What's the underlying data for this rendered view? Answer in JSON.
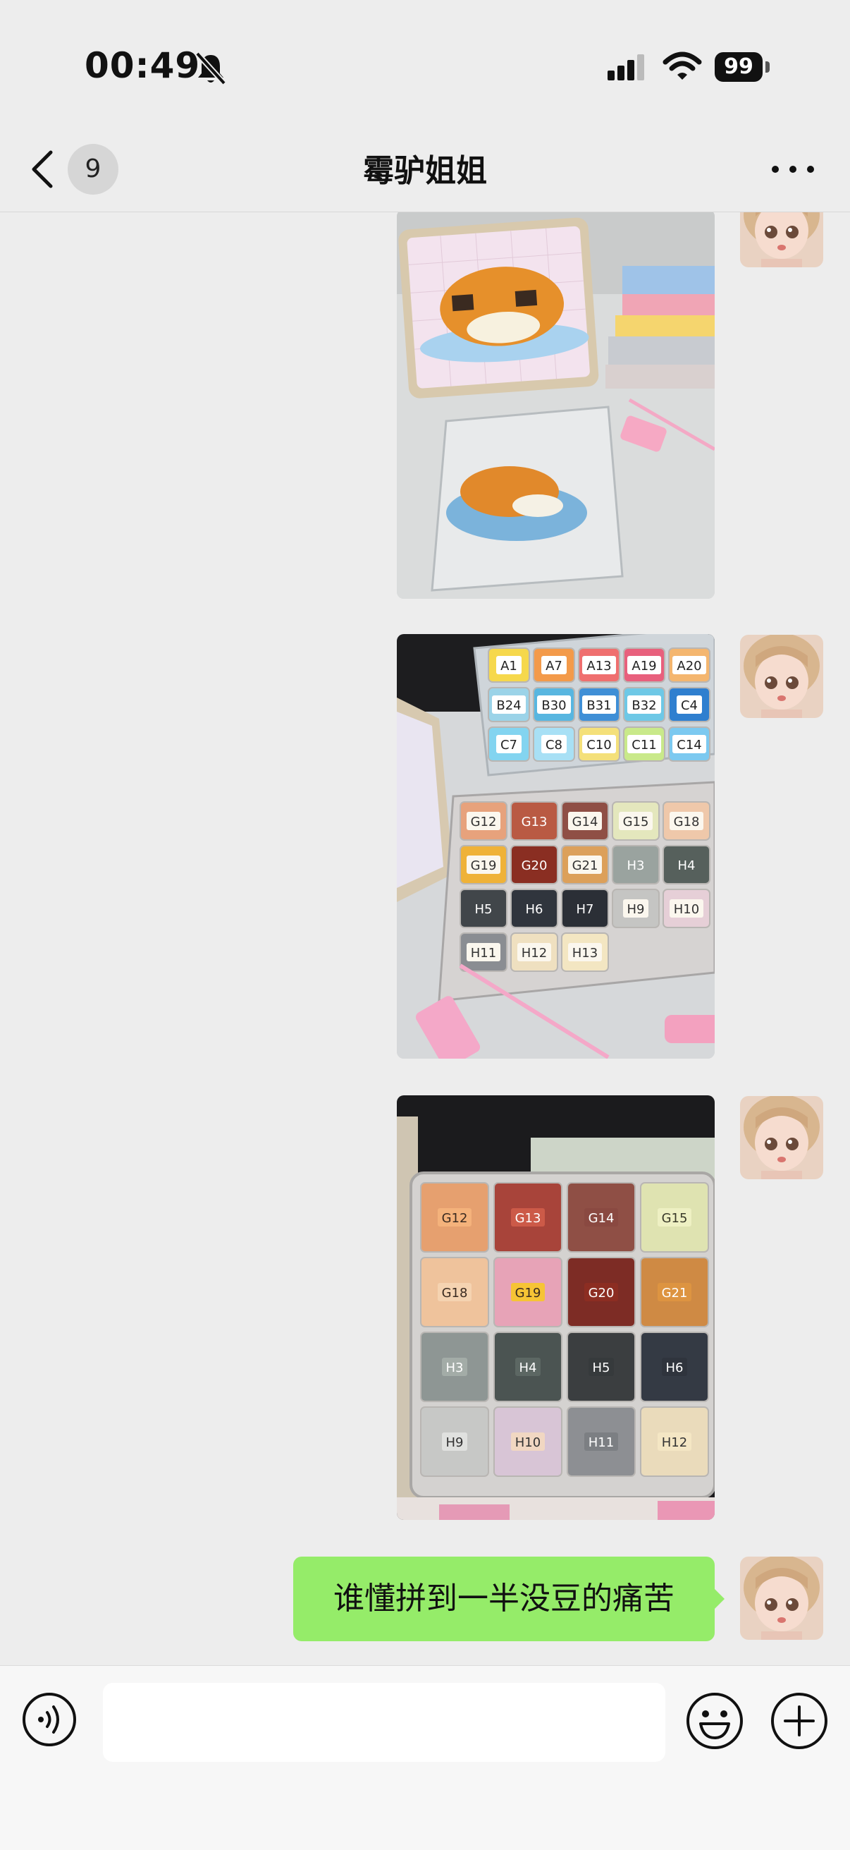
{
  "status_bar": {
    "time": "00:49",
    "battery": "99"
  },
  "nav": {
    "unread_count": "9",
    "title": "霉驴姐姐"
  },
  "messages": [
    {
      "type": "image",
      "description_icon": "photo"
    },
    {
      "type": "image",
      "description_icon": "photo"
    },
    {
      "type": "image",
      "description_icon": "photo"
    },
    {
      "type": "text",
      "text": "谁懂拼到一半没豆的痛苦"
    }
  ],
  "image_labels": {
    "msg2_top": [
      "A1",
      "A7",
      "A13",
      "A19",
      "A20",
      "B24",
      "B30",
      "B31",
      "B32",
      "C4",
      "C7",
      "C8",
      "C10",
      "C11",
      "C14"
    ],
    "msg2_bottom": [
      "G12",
      "G13",
      "G14",
      "G15",
      "G18",
      "G19",
      "G20",
      "G21",
      "H3",
      "H4",
      "H5",
      "H6",
      "H7",
      "H9",
      "H10",
      "H11",
      "H12",
      "H13"
    ],
    "msg3_grid": [
      [
        "G12",
        "G13",
        "G14",
        "G15"
      ],
      [
        "G18",
        "G19",
        "G20",
        "G21"
      ],
      [
        "H3",
        "H4",
        "H5",
        "H6"
      ],
      [
        "H9",
        "H10",
        "H11",
        "H12"
      ]
    ]
  },
  "colors": {
    "page_bg": "#ededed",
    "bubble_green": "#95ec69",
    "composer_bg": "#f7f7f7"
  }
}
